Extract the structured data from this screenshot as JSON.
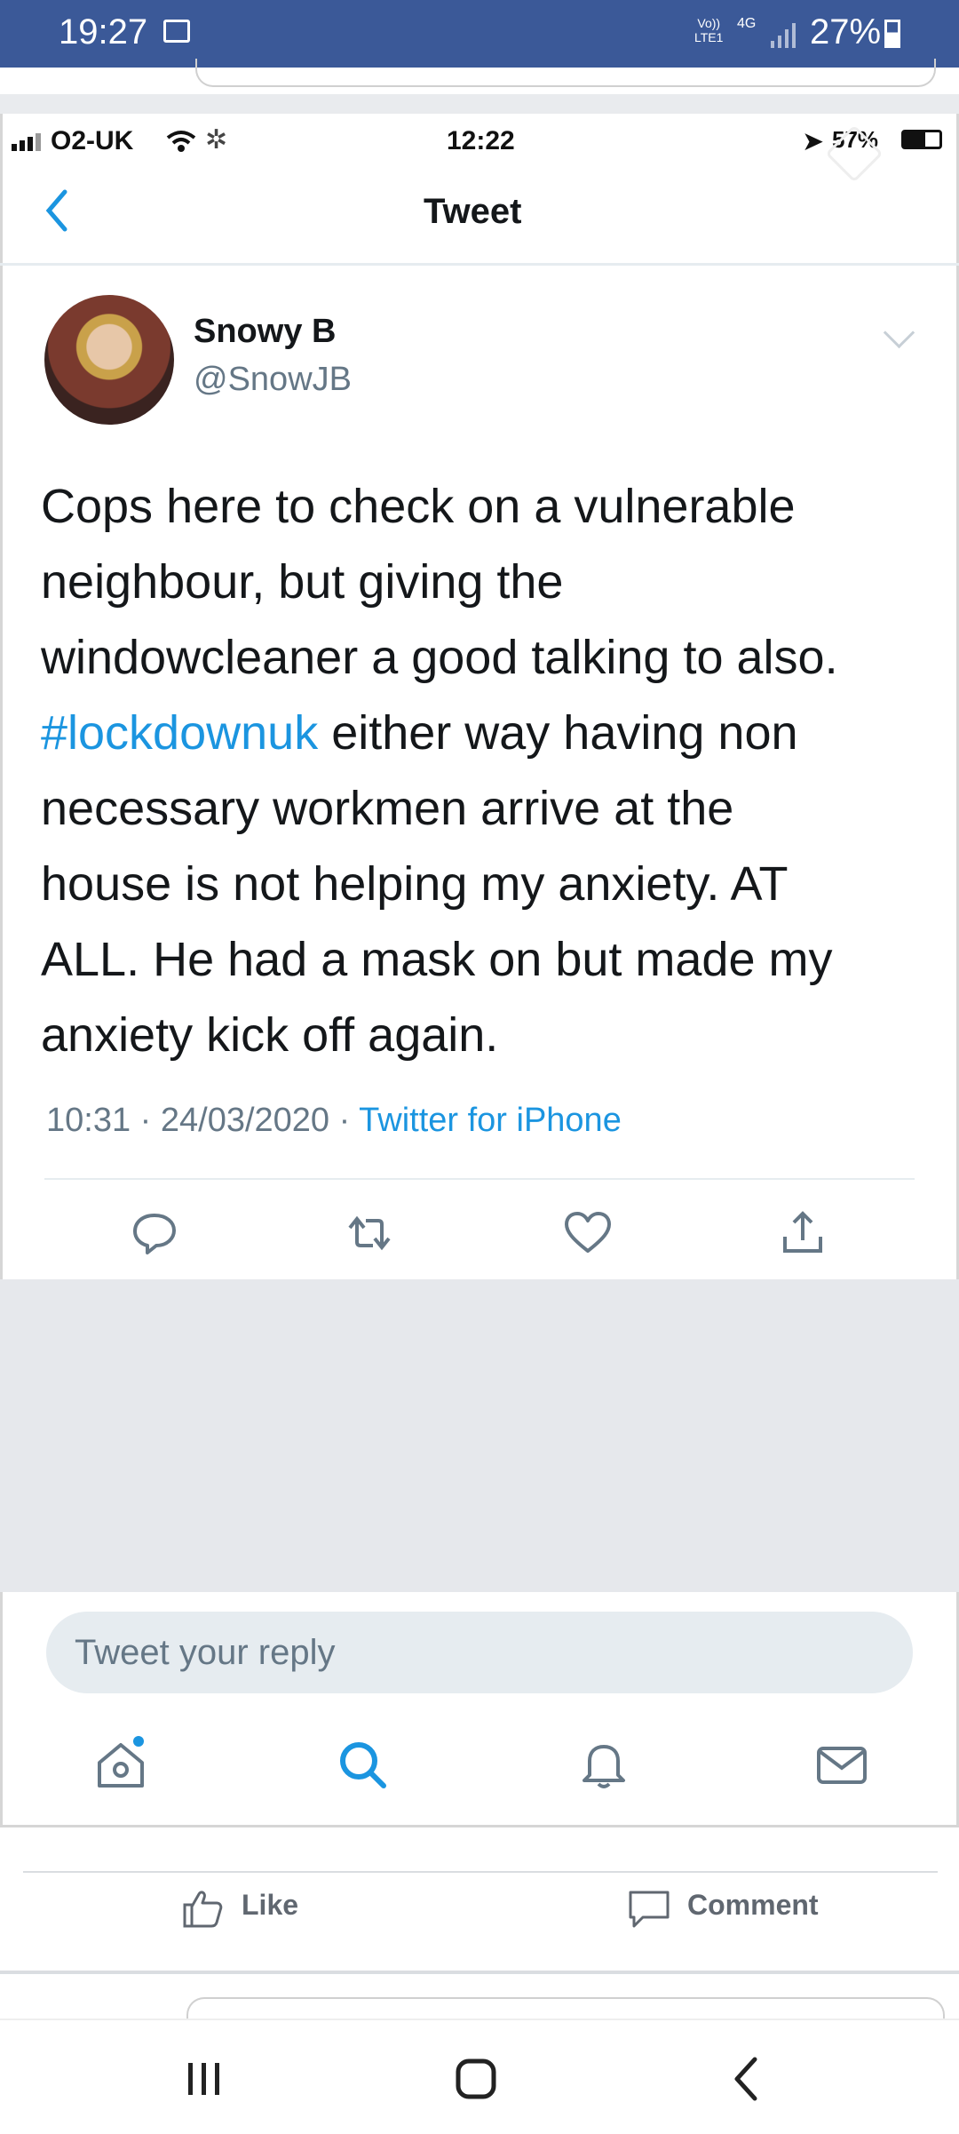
{
  "android_status": {
    "time": "19:27",
    "lte_top": "Vo))",
    "lte_bottom": "LTE1",
    "net": "4G",
    "battery": "27%"
  },
  "ios_status": {
    "carrier": "O2-UK",
    "time": "12:22",
    "battery": "57%"
  },
  "header": {
    "title": "Tweet",
    "back_icon": "chevron-left-icon"
  },
  "tweet": {
    "name": "Snowy B",
    "handle": "@SnowJB",
    "lines": [
      "Cops here to check on a vulnerable",
      "neighbour, but giving the",
      "windowcleaner a good talking to also."
    ],
    "hashtag": "#lockdownuk",
    "hashtag_rest": " either way having non",
    "lines2": [
      "necessary workmen arrive at the",
      "house is not helping my anxiety. AT",
      "ALL. He had a mask on but made my",
      "anxiety kick off again."
    ],
    "timestamp": "10:31 · 24/03/2020 ·",
    "source": "Twitter for iPhone"
  },
  "actions": [
    "reply-icon",
    "retweet-icon",
    "like-heart-icon",
    "share-icon"
  ],
  "reply": {
    "placeholder": "Tweet your reply"
  },
  "tabs": [
    "home-icon",
    "search-icon",
    "notifications-bell-icon",
    "messages-mail-icon"
  ],
  "facebook": {
    "like_label": "Like",
    "comment_label": "Comment"
  },
  "colors": {
    "twitter_blue": "#1b95e0",
    "fb_blue": "#3b5998"
  }
}
